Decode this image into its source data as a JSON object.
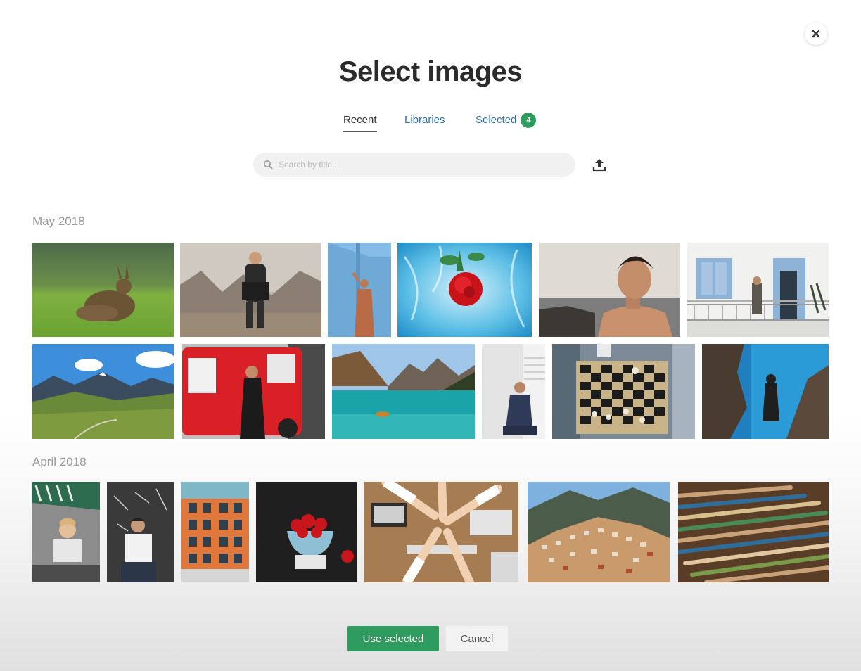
{
  "dialog": {
    "title": "Select images",
    "close_icon": "close-icon"
  },
  "tabs": [
    {
      "label": "Recent",
      "active": true
    },
    {
      "label": "Libraries",
      "active": false
    },
    {
      "label": "Selected",
      "active": false,
      "count": "4"
    }
  ],
  "search": {
    "placeholder": "Search by title...",
    "icon": "search-icon"
  },
  "upload": {
    "icon": "upload-icon"
  },
  "sections": [
    {
      "label": "May 2018",
      "images": [
        {
          "subject": "hare in green field"
        },
        {
          "subject": "woman with laptop on rocks"
        },
        {
          "subject": "woman in dress by blue wall"
        },
        {
          "subject": "red rose in water"
        },
        {
          "subject": "shirtless man by sea"
        },
        {
          "subject": "building with blue shutters"
        },
        {
          "subject": "mountain valley"
        },
        {
          "subject": "woman by red bus"
        },
        {
          "subject": "turquoise lake and mountains"
        },
        {
          "subject": "person sitting by window"
        },
        {
          "subject": "chess board"
        },
        {
          "subject": "diver underwater"
        }
      ]
    },
    {
      "label": "April 2018",
      "images": [
        {
          "subject": "girl resting head on hands"
        },
        {
          "subject": "man with cap by blackboard"
        },
        {
          "subject": "orange building facade"
        },
        {
          "subject": "bowl of strawberries"
        },
        {
          "subject": "team hands together"
        },
        {
          "subject": "hillside town"
        },
        {
          "subject": "paint brushes"
        }
      ]
    }
  ],
  "footer": {
    "primary_label": "Use selected",
    "secondary_label": "Cancel"
  },
  "colors": {
    "accent": "#2e9b5f",
    "link": "#2f6fb1"
  }
}
